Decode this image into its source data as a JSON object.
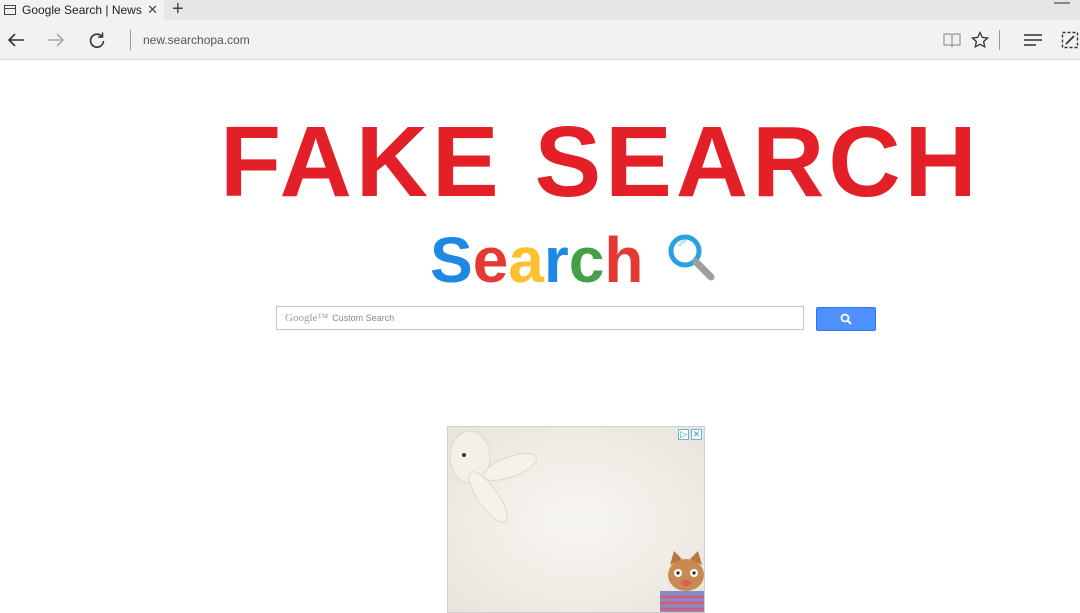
{
  "browser": {
    "tab": {
      "title": "Google Search | News sea",
      "close_glyph": "✕"
    },
    "new_tab_glyph": "+",
    "window_min_glyph": "—",
    "address_bar": {
      "url": "new.searchopa.com"
    }
  },
  "page": {
    "banner": "FAKE SEARCH",
    "logo_letters": [
      {
        "char": "S",
        "color": "#1e88e5"
      },
      {
        "char": "e",
        "color": "#e53935"
      },
      {
        "char": "a",
        "color": "#fbc02d"
      },
      {
        "char": "r",
        "color": "#1e88e5"
      },
      {
        "char": "c",
        "color": "#43a047"
      },
      {
        "char": "h",
        "color": "#e53935"
      }
    ],
    "search": {
      "brand": "Google™",
      "placeholder": "Custom Search"
    }
  },
  "colors": {
    "banner_red": "#e32027",
    "search_button": "#4d90fe"
  }
}
